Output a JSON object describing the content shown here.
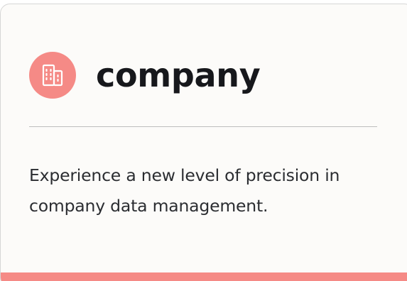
{
  "card": {
    "title": "company",
    "description": "Experience a new level of precision in company data management.",
    "icon": "building-icon"
  },
  "colors": {
    "accent": "#f58a86",
    "card_background": "#fcfbf9",
    "title_text": "#17181c",
    "body_text": "#2b2d31",
    "divider": "#bdbdbd"
  }
}
